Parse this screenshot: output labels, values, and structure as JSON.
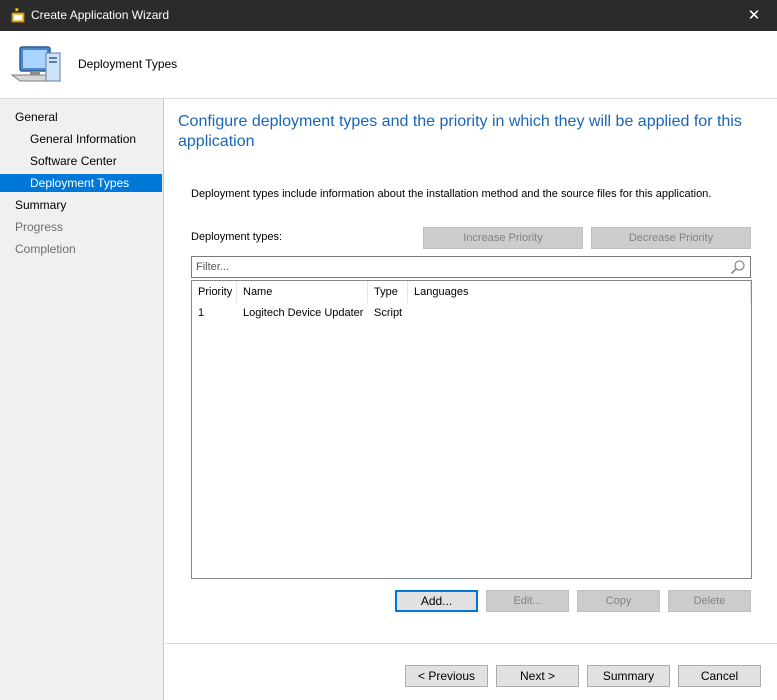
{
  "window": {
    "title": "Create Application Wizard",
    "close_glyph": "✕",
    "app_icon": "wizard-app-icon"
  },
  "header": {
    "title": "Deployment Types",
    "icon": "computer-icon"
  },
  "sidebar": {
    "items": [
      {
        "label": "General",
        "level": 0,
        "state": "normal"
      },
      {
        "label": "General Information",
        "level": 1,
        "state": "normal"
      },
      {
        "label": "Software Center",
        "level": 1,
        "state": "normal"
      },
      {
        "label": "Deployment Types",
        "level": 1,
        "state": "selected"
      },
      {
        "label": "Summary",
        "level": 0,
        "state": "normal"
      },
      {
        "label": "Progress",
        "level": 0,
        "state": "disabled"
      },
      {
        "label": "Completion",
        "level": 0,
        "state": "disabled"
      }
    ]
  },
  "main": {
    "heading": "Configure deployment types and the priority in which they will be applied for this application",
    "description": "Deployment types include information about the installation method and the source files for this application.",
    "deployment_types_label": "Deployment types:",
    "increase_priority_label": "Increase Priority",
    "decrease_priority_label": "Decrease Priority",
    "filter": {
      "placeholder": "Filter...",
      "value": ""
    },
    "list": {
      "columns": [
        "Priority",
        "Name",
        "Type",
        "Languages"
      ],
      "rows": [
        {
          "priority": "1",
          "name": "Logitech Device Updater",
          "type": "Script",
          "languages": ""
        }
      ]
    },
    "add_label": "Add...",
    "edit_label": "Edit...",
    "copy_label": "Copy",
    "delete_label": "Delete"
  },
  "footer": {
    "previous_label": "< Previous",
    "next_label": "Next >",
    "summary_label": "Summary",
    "cancel_label": "Cancel"
  },
  "colors": {
    "title_bar": "#2b2b2b",
    "accent": "#0078d7",
    "heading_text": "#1a66b3",
    "sidebar_bg": "#f0f0f0"
  }
}
